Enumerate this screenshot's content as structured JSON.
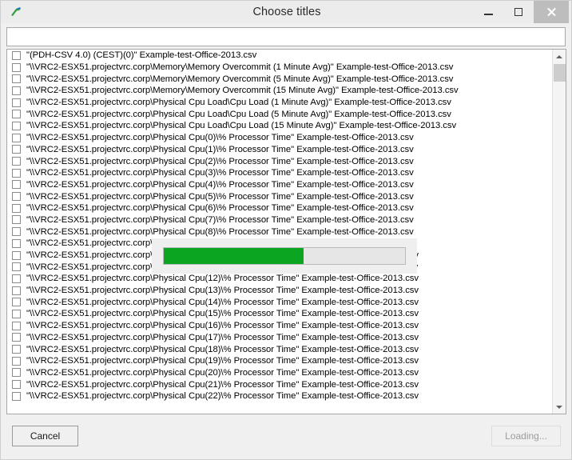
{
  "window": {
    "title": "Choose titles",
    "icon": "app-logo-icon",
    "controls": {
      "minimize": "minimize-icon",
      "maximize": "maximize-icon",
      "close": "close-icon"
    }
  },
  "filter": {
    "value": "",
    "placeholder": ""
  },
  "list": {
    "items": [
      "\"(PDH-CSV 4.0) (CEST)(0)\" Example-test-Office-2013.csv",
      "\"\\\\VRC2-ESX51.projectvrc.corp\\Memory\\Memory Overcommit (1 Minute Avg)\" Example-test-Office-2013.csv",
      "\"\\\\VRC2-ESX51.projectvrc.corp\\Memory\\Memory Overcommit (5 Minute Avg)\" Example-test-Office-2013.csv",
      "\"\\\\VRC2-ESX51.projectvrc.corp\\Memory\\Memory Overcommit (15 Minute Avg)\" Example-test-Office-2013.csv",
      "\"\\\\VRC2-ESX51.projectvrc.corp\\Physical Cpu Load\\Cpu Load (1 Minute Avg)\" Example-test-Office-2013.csv",
      "\"\\\\VRC2-ESX51.projectvrc.corp\\Physical Cpu Load\\Cpu Load (5 Minute Avg)\" Example-test-Office-2013.csv",
      "\"\\\\VRC2-ESX51.projectvrc.corp\\Physical Cpu Load\\Cpu Load (15 Minute Avg)\" Example-test-Office-2013.csv",
      "\"\\\\VRC2-ESX51.projectvrc.corp\\Physical Cpu(0)\\% Processor Time\" Example-test-Office-2013.csv",
      "\"\\\\VRC2-ESX51.projectvrc.corp\\Physical Cpu(1)\\% Processor Time\" Example-test-Office-2013.csv",
      "\"\\\\VRC2-ESX51.projectvrc.corp\\Physical Cpu(2)\\% Processor Time\" Example-test-Office-2013.csv",
      "\"\\\\VRC2-ESX51.projectvrc.corp\\Physical Cpu(3)\\% Processor Time\" Example-test-Office-2013.csv",
      "\"\\\\VRC2-ESX51.projectvrc.corp\\Physical Cpu(4)\\% Processor Time\" Example-test-Office-2013.csv",
      "\"\\\\VRC2-ESX51.projectvrc.corp\\Physical Cpu(5)\\% Processor Time\" Example-test-Office-2013.csv",
      "\"\\\\VRC2-ESX51.projectvrc.corp\\Physical Cpu(6)\\% Processor Time\" Example-test-Office-2013.csv",
      "\"\\\\VRC2-ESX51.projectvrc.corp\\Physical Cpu(7)\\% Processor Time\" Example-test-Office-2013.csv",
      "\"\\\\VRC2-ESX51.projectvrc.corp\\Physical Cpu(8)\\% Processor Time\" Example-test-Office-2013.csv",
      "\"\\\\VRC2-ESX51.projectvrc.corp\\Physical Cpu(9)\\% Processor Time\" Example-test-Office-2013.csv",
      "\"\\\\VRC2-ESX51.projectvrc.corp\\Physical Cpu(10)\\% Processor Time\" Example-test-Office-2013.csv",
      "\"\\\\VRC2-ESX51.projectvrc.corp\\Physical Cpu(11)\\% Processor Time\" Example-test-Office-2013.csv",
      "\"\\\\VRC2-ESX51.projectvrc.corp\\Physical Cpu(12)\\% Processor Time\" Example-test-Office-2013.csv",
      "\"\\\\VRC2-ESX51.projectvrc.corp\\Physical Cpu(13)\\% Processor Time\" Example-test-Office-2013.csv",
      "\"\\\\VRC2-ESX51.projectvrc.corp\\Physical Cpu(14)\\% Processor Time\" Example-test-Office-2013.csv",
      "\"\\\\VRC2-ESX51.projectvrc.corp\\Physical Cpu(15)\\% Processor Time\" Example-test-Office-2013.csv",
      "\"\\\\VRC2-ESX51.projectvrc.corp\\Physical Cpu(16)\\% Processor Time\" Example-test-Office-2013.csv",
      "\"\\\\VRC2-ESX51.projectvrc.corp\\Physical Cpu(17)\\% Processor Time\" Example-test-Office-2013.csv",
      "\"\\\\VRC2-ESX51.projectvrc.corp\\Physical Cpu(18)\\% Processor Time\" Example-test-Office-2013.csv",
      "\"\\\\VRC2-ESX51.projectvrc.corp\\Physical Cpu(19)\\% Processor Time\" Example-test-Office-2013.csv",
      "\"\\\\VRC2-ESX51.projectvrc.corp\\Physical Cpu(20)\\% Processor Time\" Example-test-Office-2013.csv",
      "\"\\\\VRC2-ESX51.projectvrc.corp\\Physical Cpu(21)\\% Processor Time\" Example-test-Office-2013.csv",
      "\"\\\\VRC2-ESX51.projectvrc.corp\\Physical Cpu(22)\\% Processor Time\" Example-test-Office-2013.csv"
    ],
    "checked": false,
    "scrollbar": {
      "up_icon": "chevron-up-icon",
      "down_icon": "chevron-down-icon"
    }
  },
  "progress": {
    "percent": 58,
    "fill_color": "#0ba521",
    "track_color": "#e6e6e6",
    "overlay_color": "#efefef"
  },
  "footer": {
    "cancel_label": "Cancel",
    "loading_label": "Loading..."
  }
}
